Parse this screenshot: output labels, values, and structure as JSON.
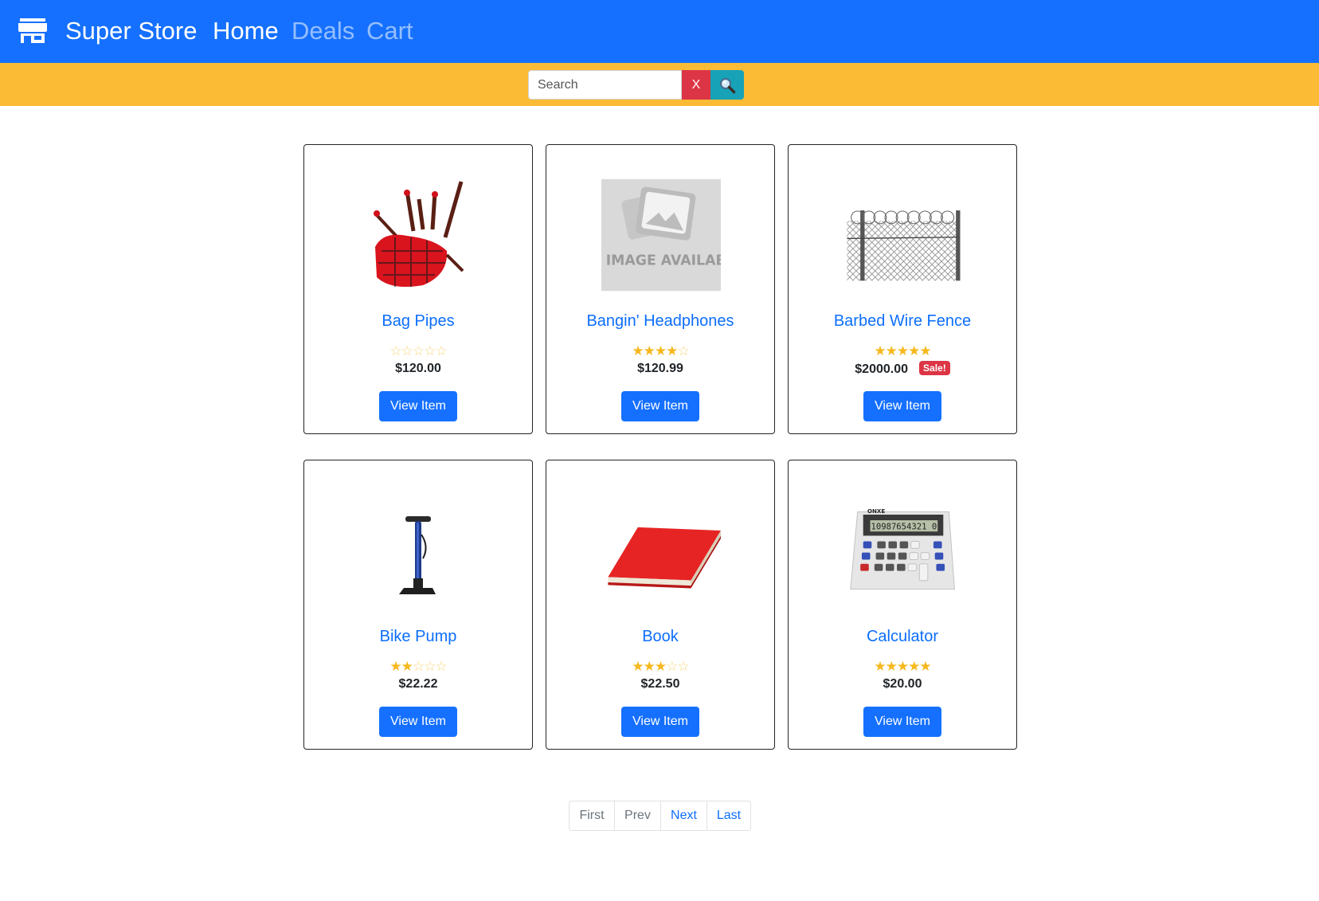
{
  "navbar": {
    "brand": "Super Store",
    "links": [
      {
        "label": "Home",
        "active": true
      },
      {
        "label": "Deals",
        "active": false
      },
      {
        "label": "Cart",
        "active": false
      }
    ],
    "colors": {
      "bar": "#1570ff"
    }
  },
  "search": {
    "placeholder": "Search",
    "value": "",
    "clear_label": "X",
    "submit_icon": "magnifying-glass-icon",
    "colors": {
      "bar": "#fbbb34",
      "clear": "#dc3545",
      "submit": "#17a2b8"
    }
  },
  "products": [
    {
      "name": "Bag Pipes",
      "rating": 0,
      "max_rating": 5,
      "price": "$120.00",
      "sale": "",
      "button": "View Item",
      "image": "bag-pipes-image"
    },
    {
      "name": "Bangin' Headphones",
      "rating": 4,
      "max_rating": 5,
      "price": "$120.99",
      "sale": "",
      "button": "View Item",
      "image": "no-image-placeholder",
      "image_text": "NO IMAGE AVAILABLE"
    },
    {
      "name": "Barbed Wire Fence",
      "rating": 5,
      "max_rating": 5,
      "price": "$2000.00",
      "sale": "Sale!",
      "button": "View Item",
      "image": "barbed-wire-fence-image"
    },
    {
      "name": "Bike Pump",
      "rating": 2,
      "max_rating": 5,
      "price": "$22.22",
      "sale": "",
      "button": "View Item",
      "image": "bike-pump-image"
    },
    {
      "name": "Book",
      "rating": 3,
      "max_rating": 5,
      "price": "$22.50",
      "sale": "",
      "button": "View Item",
      "image": "red-book-image"
    },
    {
      "name": "Calculator",
      "rating": 5,
      "max_rating": 5,
      "price": "$20.00",
      "sale": "",
      "button": "View Item",
      "image": "calculator-image",
      "image_text": "ONXE",
      "display_text": "10987654321 0"
    }
  ],
  "pagination": [
    {
      "label": "First",
      "enabled": false
    },
    {
      "label": "Prev",
      "enabled": false
    },
    {
      "label": "Next",
      "enabled": true
    },
    {
      "label": "Last",
      "enabled": true
    }
  ]
}
